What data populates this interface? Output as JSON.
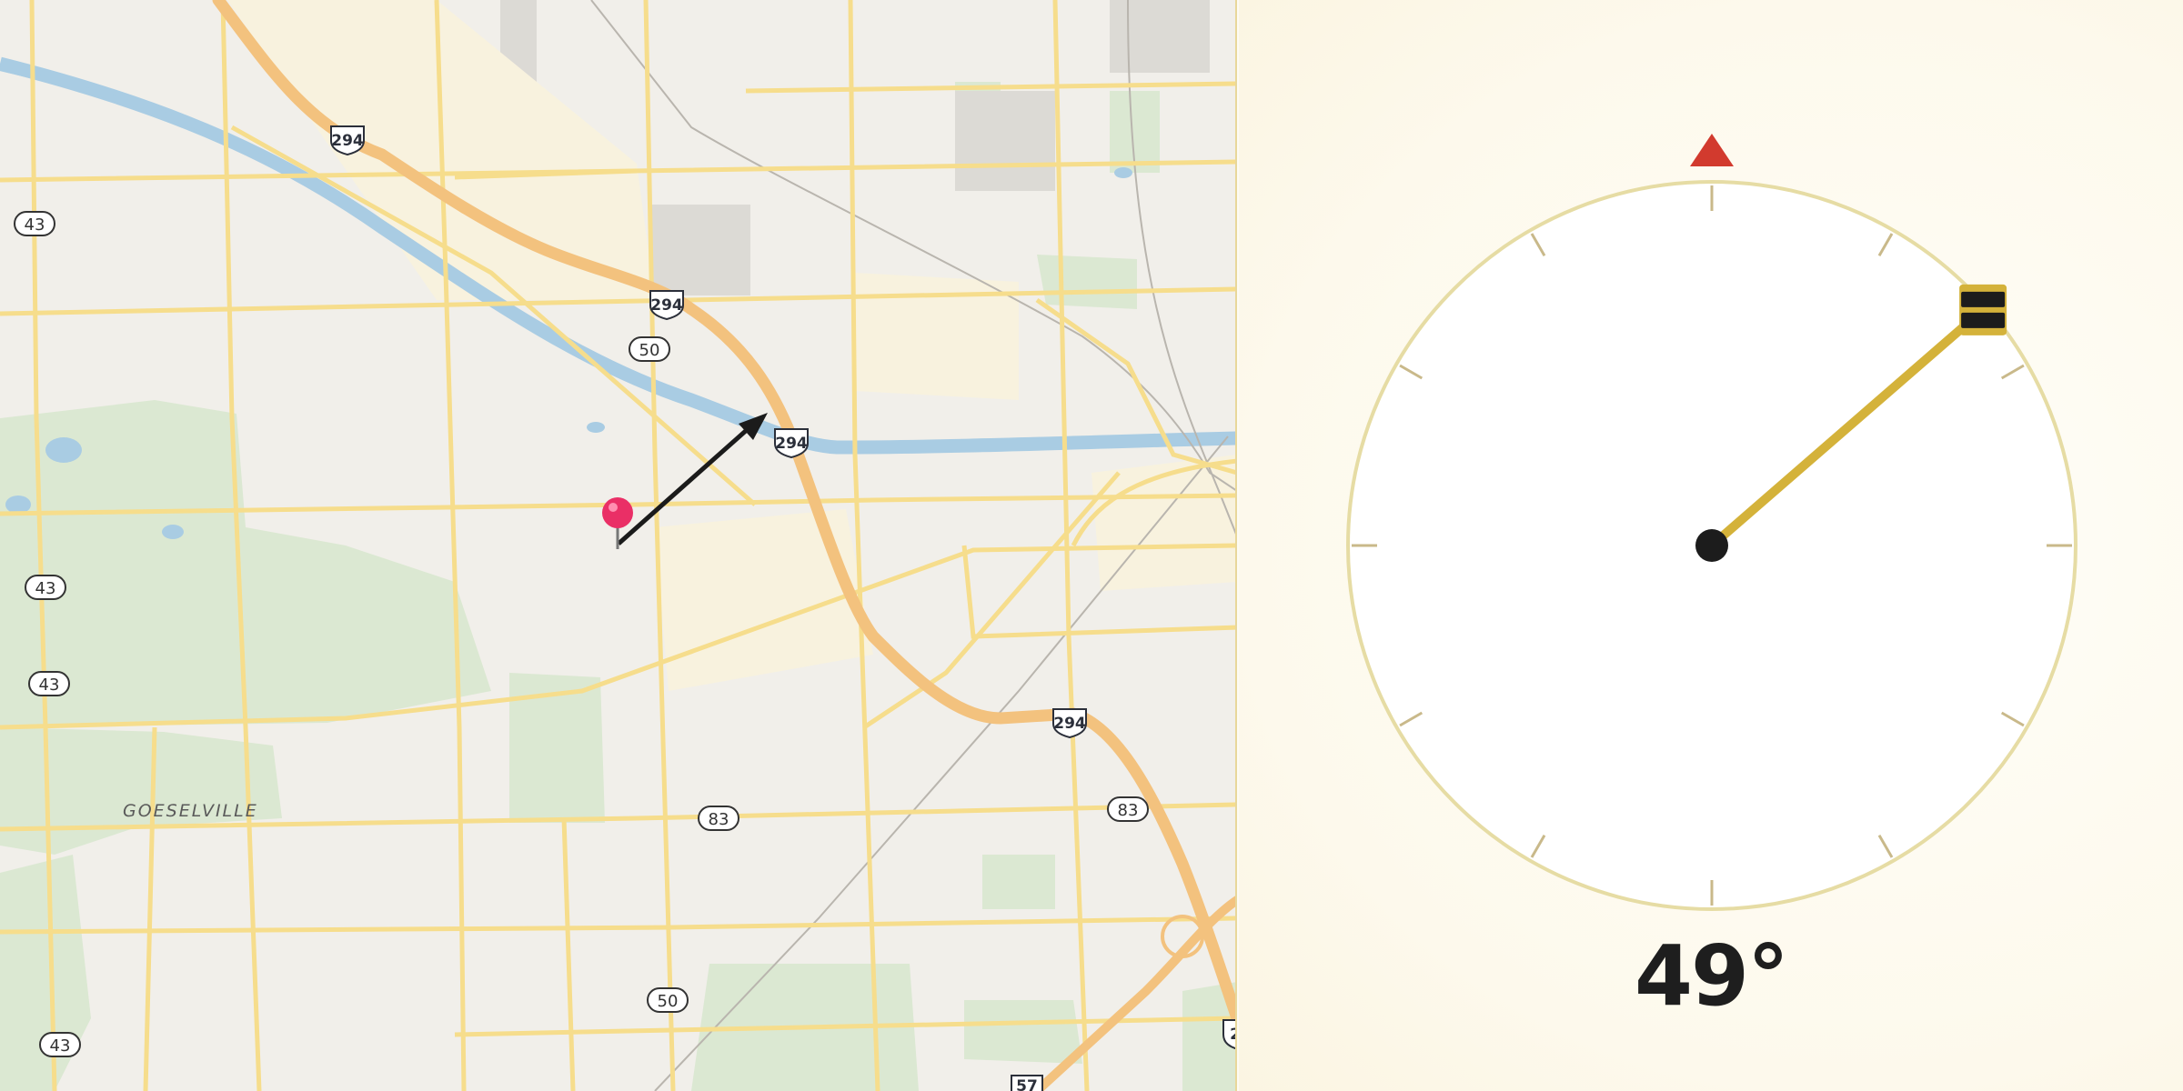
{
  "map": {
    "town_label": "GOESELVILLE",
    "us_route_43": "43",
    "us_route_50": "50",
    "us_route_83": "83",
    "us_route_57": "57",
    "interstate_294": "294",
    "interstate_partial": "2"
  },
  "compass": {
    "heading_deg": 49,
    "heading_text": "49°",
    "colors": {
      "north_marker": "#d23a2e",
      "needle": "#d4b23a",
      "dial_ring": "#e6dca4"
    }
  }
}
